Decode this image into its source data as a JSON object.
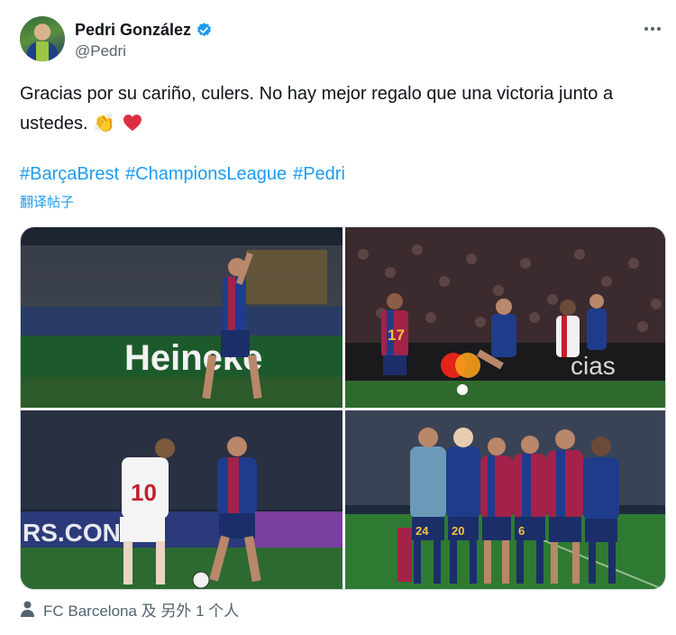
{
  "author": {
    "display_name": "Pedri González",
    "handle": "@Pedri",
    "verified": true
  },
  "tweet": {
    "text": "Gracias por su cariño, culers. No hay mejor regalo que una victoria junto a ustedes.",
    "emoji_clap": "👏",
    "hashtags": [
      "#BarçaBrest",
      "#ChampionsLeague",
      "#Pedri"
    ],
    "translate_label": "翻译帖子"
  },
  "media": {
    "photo_1_banner": "Heineke",
    "photo_2_banner": "cias",
    "photo_2_jersey_number": "17",
    "photo_3_banner": "RS.CON",
    "photo_3_jersey_number": "10",
    "photo_4_jersey_numbers": [
      "24",
      "20",
      "6"
    ]
  },
  "tagged": {
    "label": "FC Barcelona 及 另外 1 个人"
  },
  "colors": {
    "accent": "#1d9bf0",
    "secondary_text": "#536471",
    "verified_badge": "#1d9bf0",
    "heart": "#f91880"
  },
  "icons": {
    "verified": "verified-badge-icon",
    "more": "more-options-icon",
    "person": "person-icon",
    "heart": "red-heart-emoji"
  }
}
